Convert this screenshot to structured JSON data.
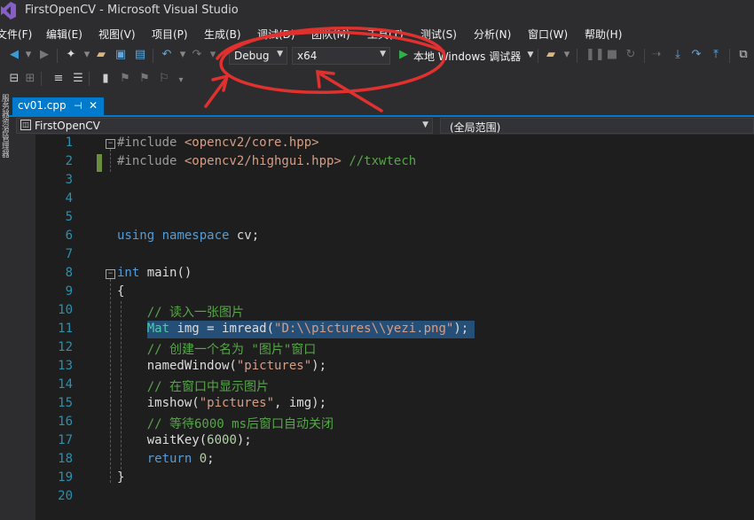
{
  "window": {
    "title": "FirstOpenCV - Microsoft Visual Studio"
  },
  "menu": [
    "文件(F)",
    "编辑(E)",
    "视图(V)",
    "项目(P)",
    "生成(B)",
    "调试(D)",
    "团队(M)",
    "工具(T)",
    "测试(S)",
    "分析(N)",
    "窗口(W)",
    "帮助(H)"
  ],
  "toolbar": {
    "config": "Debug",
    "platform": "x64",
    "run_label": "本地 Windows 调试器"
  },
  "left_strip": {
    "label": "服务器资源管理器"
  },
  "tab": {
    "label": "cv01.cpp",
    "pin": "⊣",
    "close": "✕"
  },
  "navbar": {
    "project": "FirstOpenCV",
    "scope": "(全局范围)"
  },
  "editor": {
    "line_numbers": [
      "1",
      "2",
      "3",
      "4",
      "5",
      "6",
      "7",
      "8",
      "9",
      "10",
      "11",
      "12",
      "13",
      "14",
      "15",
      "16",
      "17",
      "18",
      "19",
      "20"
    ],
    "lines": [
      "#include <opencv2/core.hpp>",
      "#include <opencv2/highgui.hpp> //txwtech",
      "",
      "",
      "",
      "using namespace cv;",
      "",
      "int main()",
      "{",
      "    // 读入一张图片",
      "    Mat img = imread(\"D:\\\\pictures\\\\yezi.png\");",
      "    // 创建一个名为 \"图片\"窗口",
      "    namedWindow(\"pictures\");",
      "    // 在窗口中显示图片",
      "    imshow(\"pictures\", img);",
      "    // 等待6000 ms后窗口自动关闭",
      "    waitKey(6000);",
      "    return 0;",
      "}",
      ""
    ]
  },
  "colors": {
    "accent": "#007acc",
    "keyword": "#569cd6",
    "comment": "#57a64a",
    "string": "#d69d85",
    "type": "#4ec9b0",
    "line_number": "#2b91af",
    "annotation": "#e0312f"
  }
}
